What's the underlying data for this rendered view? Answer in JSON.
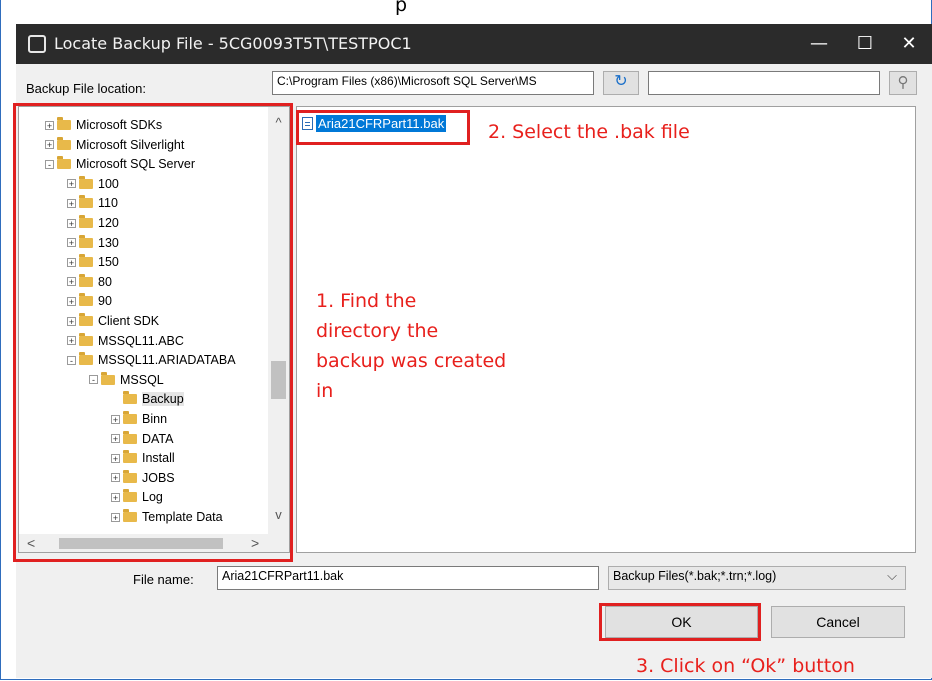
{
  "top_cut_text": "p",
  "window": {
    "title": "Locate Backup File - 5CG0093T5T\\TESTPOC1",
    "minimize_glyph": "—",
    "maximize_glyph": "☐",
    "close_glyph": "✕"
  },
  "location": {
    "label": "Backup File location:",
    "value": "C:\\Program Files (x86)\\Microsoft SQL Server\\MS",
    "refresh_glyph": "↻",
    "search_value": "",
    "search_glyph": "⚲"
  },
  "tree": {
    "scroll_up": "^",
    "scroll_down": "v",
    "scroll_left": "<",
    "scroll_right": ">",
    "items": [
      {
        "label": "Microsoft SDKs",
        "level": 0,
        "exp": "+"
      },
      {
        "label": "Microsoft Silverlight",
        "level": 0,
        "exp": "+"
      },
      {
        "label": "Microsoft SQL Server",
        "level": 0,
        "exp": "-"
      },
      {
        "label": "100",
        "level": 1,
        "exp": "+"
      },
      {
        "label": "110",
        "level": 1,
        "exp": "+"
      },
      {
        "label": "120",
        "level": 1,
        "exp": "+"
      },
      {
        "label": "130",
        "level": 1,
        "exp": "+"
      },
      {
        "label": "150",
        "level": 1,
        "exp": "+"
      },
      {
        "label": "80",
        "level": 1,
        "exp": "+"
      },
      {
        "label": "90",
        "level": 1,
        "exp": "+"
      },
      {
        "label": "Client SDK",
        "level": 1,
        "exp": "+"
      },
      {
        "label": "MSSQL11.ABC",
        "level": 1,
        "exp": "+"
      },
      {
        "label": "MSSQL11.ARIADATABA",
        "level": 1,
        "exp": "-"
      },
      {
        "label": "MSSQL",
        "level": 2,
        "exp": "-"
      },
      {
        "label": "Backup",
        "level": 3,
        "exp": "",
        "selected": true
      },
      {
        "label": "Binn",
        "level": 3,
        "exp": "+"
      },
      {
        "label": "DATA",
        "level": 3,
        "exp": "+"
      },
      {
        "label": "Install",
        "level": 3,
        "exp": "+"
      },
      {
        "label": "JOBS",
        "level": 3,
        "exp": "+"
      },
      {
        "label": "Log",
        "level": 3,
        "exp": "+"
      },
      {
        "label": "Template Data",
        "level": 3,
        "exp": "+"
      }
    ]
  },
  "files": {
    "items": [
      {
        "name": "Aria21CFRPart11.bak",
        "selected": true
      }
    ]
  },
  "annotations": {
    "step1_lines": [
      "1. Find the",
      "directory the",
      "backup was created",
      "in"
    ],
    "step2": "2. Select the .bak file",
    "step3": "3. Click on “Ok” button"
  },
  "filename": {
    "label": "File name:",
    "value": "Aria21CFRPart11.bak",
    "filter": "Backup Files(*.bak;*.trn;*.log)",
    "dropdown_glyph": "⌵"
  },
  "buttons": {
    "ok": "OK",
    "cancel": "Cancel"
  },
  "colors": {
    "annotation_red": "#e8201c",
    "title_bar": "#2b2b2b",
    "selection_blue": "#0078d7"
  }
}
